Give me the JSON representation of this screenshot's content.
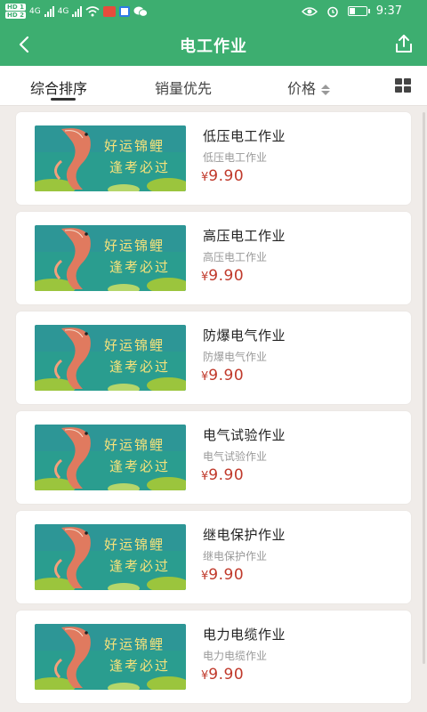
{
  "status": {
    "sim1": "HD 1",
    "sim2": "HD 2",
    "net1": "4G",
    "net2": "4G",
    "time": "9:37",
    "battery_level": 0.35
  },
  "header": {
    "title": "电工作业"
  },
  "filters": {
    "tabs": [
      "综合排序",
      "销量优先",
      "价格"
    ],
    "active_index": 0
  },
  "thumb": {
    "line1": "好运锦鲤",
    "line2": "逢考必过"
  },
  "products": [
    {
      "name": "低压电工作业",
      "subtitle": "低压电工作业",
      "currency": "¥",
      "price": "9.90"
    },
    {
      "name": "高压电工作业",
      "subtitle": "高压电工作业",
      "currency": "¥",
      "price": "9.90"
    },
    {
      "name": "防爆电气作业",
      "subtitle": "防爆电气作业",
      "currency": "¥",
      "price": "9.90"
    },
    {
      "name": "电气试验作业",
      "subtitle": "电气试验作业",
      "currency": "¥",
      "price": "9.90"
    },
    {
      "name": "继电保护作业",
      "subtitle": "继电保护作业",
      "currency": "¥",
      "price": "9.90"
    },
    {
      "name": "电力电缆作业",
      "subtitle": "电力电缆作业",
      "currency": "¥",
      "price": "9.90"
    }
  ],
  "colors": {
    "brand_green": "#3dae70",
    "price_red": "#c0392b",
    "thumb_teal": "#2a9d8f"
  }
}
